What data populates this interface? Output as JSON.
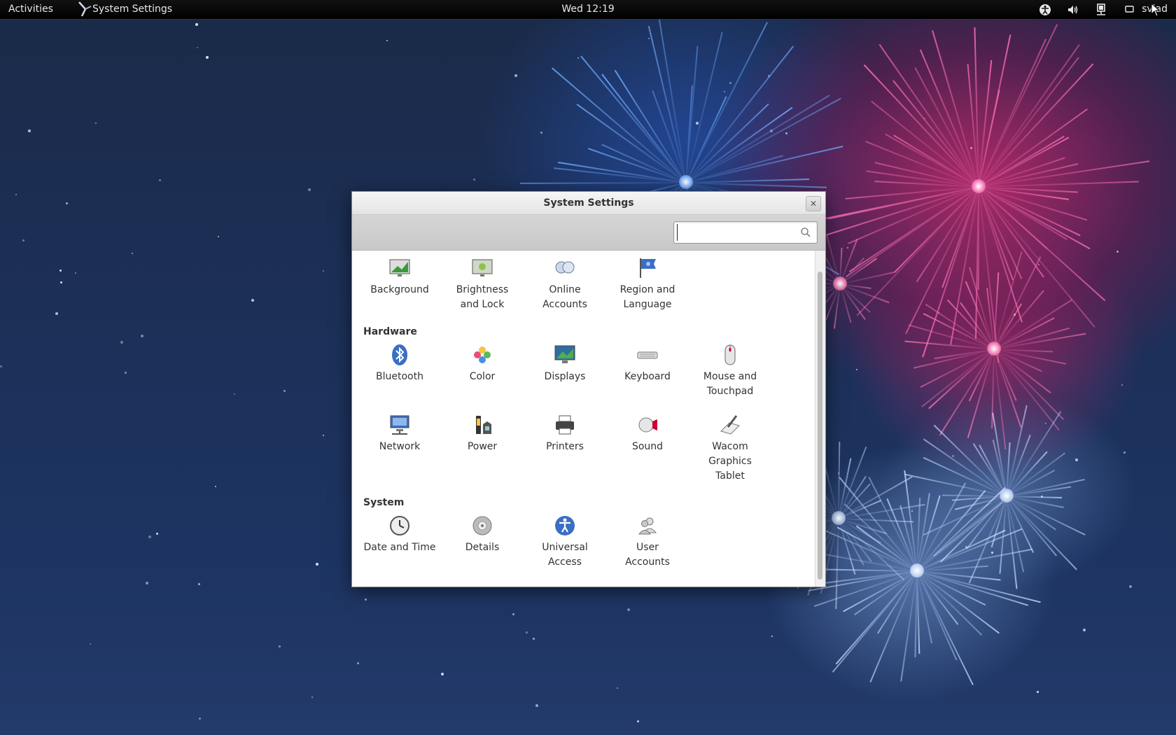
{
  "topbar": {
    "activities": "Activities",
    "app_name": "System Settings",
    "clock": "Wed 12:19",
    "user": "svlad"
  },
  "window": {
    "title": "System Settings",
    "search": {
      "value": "",
      "placeholder": ""
    }
  },
  "sections": [
    {
      "title": "",
      "items": [
        {
          "label_lines": [
            "Background"
          ],
          "icon": "background-icon"
        },
        {
          "label_lines": [
            "Brightness",
            "and Lock"
          ],
          "icon": "brightness-lock-icon"
        },
        {
          "label_lines": [
            "Online",
            "Accounts"
          ],
          "icon": "online-accounts-icon"
        },
        {
          "label_lines": [
            "Region and",
            "Language"
          ],
          "icon": "region-language-icon"
        }
      ]
    },
    {
      "title": "Hardware",
      "items": [
        {
          "label_lines": [
            "Bluetooth"
          ],
          "icon": "bluetooth-icon"
        },
        {
          "label_lines": [
            "Color"
          ],
          "icon": "color-icon"
        },
        {
          "label_lines": [
            "Displays"
          ],
          "icon": "displays-icon"
        },
        {
          "label_lines": [
            "Keyboard"
          ],
          "icon": "keyboard-icon"
        },
        {
          "label_lines": [
            "Mouse and",
            "Touchpad"
          ],
          "icon": "mouse-icon"
        },
        {
          "label_lines": [
            "Network"
          ],
          "icon": "network-icon"
        },
        {
          "label_lines": [
            "Power"
          ],
          "icon": "power-icon"
        },
        {
          "label_lines": [
            "Printers"
          ],
          "icon": "printer-icon"
        },
        {
          "label_lines": [
            "Sound"
          ],
          "icon": "sound-icon"
        },
        {
          "label_lines": [
            "Wacom",
            "Graphics",
            "Tablet"
          ],
          "icon": "wacom-tablet-icon"
        }
      ]
    },
    {
      "title": "System",
      "items": [
        {
          "label_lines": [
            "Date and Time"
          ],
          "icon": "clock-icon"
        },
        {
          "label_lines": [
            "Details"
          ],
          "icon": "details-icon"
        },
        {
          "label_lines": [
            "Universal",
            "Access"
          ],
          "icon": "universal-access-icon"
        },
        {
          "label_lines": [
            "User",
            "Accounts"
          ],
          "icon": "user-accounts-icon"
        }
      ]
    }
  ],
  "colors": {
    "topbar": "#000000",
    "accent_blue": "#3b6fc4",
    "window_bg": "#ffffff"
  }
}
